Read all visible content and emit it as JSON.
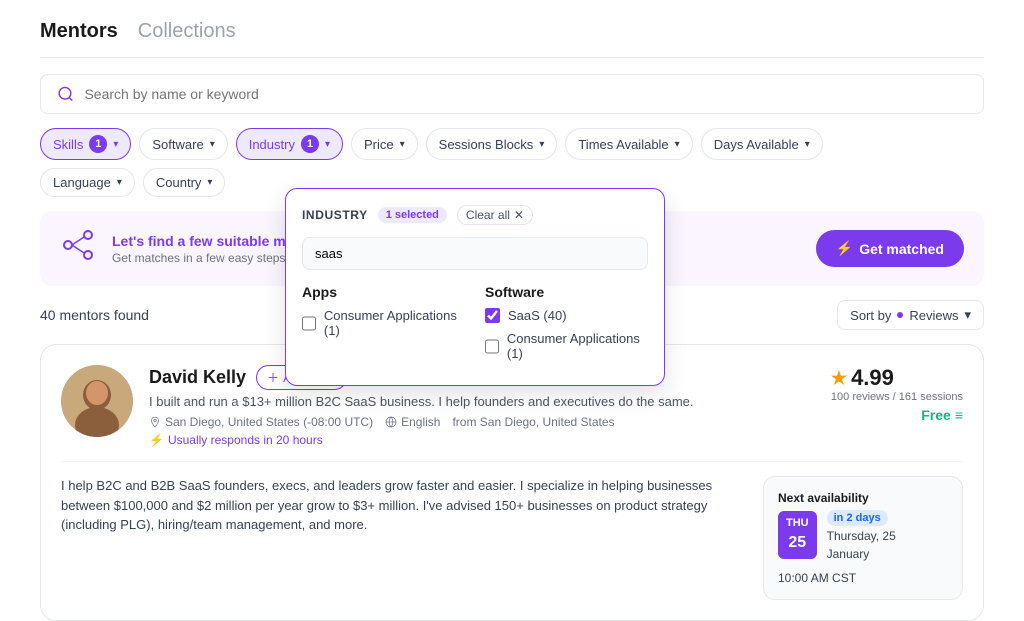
{
  "header": {
    "tab_mentors": "Mentors",
    "tab_collections": "Collections"
  },
  "search": {
    "placeholder": "Search by name or keyword"
  },
  "filters": {
    "skills": "Skills",
    "skills_count": "1",
    "software": "Software",
    "industry": "Industry",
    "industry_count": "1",
    "price": "Price",
    "sessions_blocks": "Sessions Blocks",
    "times_available": "Times Available",
    "days_available": "Days Available",
    "language": "Language",
    "country": "Country"
  },
  "dropdown": {
    "title": "INDUSTRY",
    "selected_label": "1 selected",
    "clear_label": "Clear all",
    "search_value": "saas",
    "col_apps_title": "Apps",
    "col_software_title": "Software",
    "apps_items": [
      {
        "label": "Consumer Applications (1)",
        "checked": false
      }
    ],
    "software_items": [
      {
        "label": "SaaS (40)",
        "checked": true
      },
      {
        "label": "Consumer Applications (1)",
        "checked": false
      }
    ]
  },
  "banner": {
    "title": "Let's find a few suitable mentors for you",
    "subtitle": "Get matches in a few easy steps based on your preferences and availabilities.",
    "button": "Get matched"
  },
  "results": {
    "count": "40 mentors found",
    "sort_label": "Sort by",
    "sort_value": "Reviews"
  },
  "mentor": {
    "name": "David Kelly",
    "add_to_list": "Add to list",
    "bio": "I built and run a $13+ million B2C SaaS business. I help founders and executives do the same.",
    "location": "San Diego, United States (-08:00 UTC)",
    "language": "English",
    "from": "from San Diego, United States",
    "response": "Usually responds in 20 hours",
    "rating": "4.99",
    "reviews": "100 reviews / 161 sessions",
    "price": "Free",
    "description": "I help B2C and B2B SaaS founders, execs, and leaders grow faster and easier. I specialize in helping businesses between $100,000 and $2 million per year grow to $3+ million. I've advised 150+ businesses on product strategy (including PLG), hiring/team management, and more.",
    "avail_day": "THU",
    "avail_num": "25",
    "avail_label": "Next availability",
    "in_days": "in 2 days",
    "avail_date": "Thursday, 25",
    "avail_month": "January",
    "avail_time": "10:00 AM CST"
  }
}
